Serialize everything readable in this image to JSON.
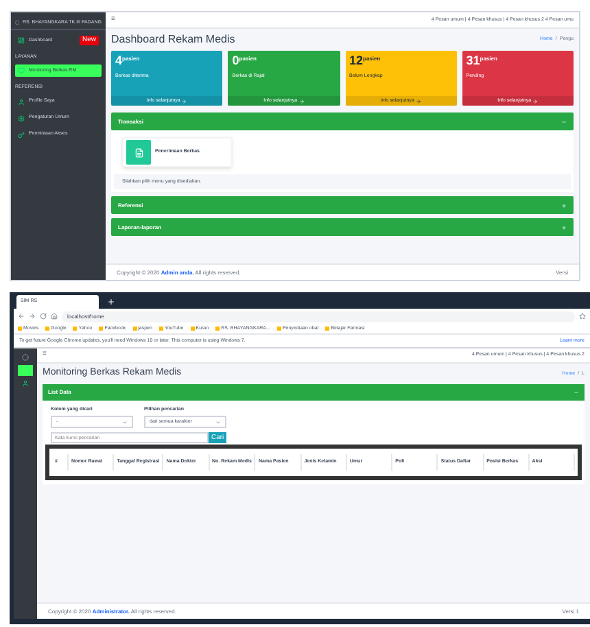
{
  "dashboard": {
    "sidebar": {
      "brand": "RS. BHAYANGKARA TK.III PADANG",
      "items": [
        {
          "kind": "link",
          "label": "Dashboard",
          "badge": "New",
          "selected": false
        },
        {
          "kind": "header",
          "label": "LAYANAN"
        },
        {
          "kind": "link",
          "label": "Monitoring Berkas RM",
          "selected": true
        },
        {
          "kind": "header",
          "label": "REFERENSI"
        },
        {
          "kind": "link",
          "label": "Profile Saya",
          "selected": false
        },
        {
          "kind": "link",
          "label": "Pengaturan Umum",
          "selected": false
        },
        {
          "kind": "link",
          "label": "Permintaan Akses",
          "selected": false
        }
      ]
    },
    "topbar": {
      "menu": "≡",
      "messages": "4 Pesan umum | 4 Pesan khusus | 4 Pesan khusus 2 4 Pesan umu"
    },
    "title": "Dashboard Rekam Medis",
    "breadcrumb": [
      "Home",
      "/",
      "Pengu"
    ],
    "stats": [
      {
        "value": "4",
        "unit": "pasien",
        "label": "Berkas diterima",
        "link": "Info selanjutnya",
        "color": "#17a2b8"
      },
      {
        "value": "0",
        "unit": "pasien",
        "label": "Berkas di Rajal",
        "link": "Info selanjutnya",
        "color": "#28a745"
      },
      {
        "value": "12",
        "unit": "pasien",
        "label": "Belum Lengkap",
        "link": "Info selanjutnya",
        "color": "#ffc107"
      },
      {
        "value": "31",
        "unit": "pasien",
        "label": "Pending",
        "link": "Info selanjutnya",
        "color": "#dc3545"
      }
    ],
    "sections": [
      {
        "title": "Transaksi",
        "expanded": true,
        "tiles": [
          "Penerimaan Berkas"
        ],
        "hint": "Silahkan pilih menu yang disediakan."
      },
      {
        "title": "Referensi",
        "expanded": false
      },
      {
        "title": "Laporan-laporan",
        "expanded": false
      }
    ],
    "footer": {
      "prefix": "Copyright © 2020 ",
      "link": "Admin anda.",
      "suffix": " All rights reserved.",
      "version": "Versi"
    }
  },
  "monitoring": {
    "browser": {
      "tab": "SIM RS",
      "address": "localhost/home",
      "bookmarks": [
        "Movies",
        "Google",
        "Yahoo",
        "Facebook",
        "jaspen",
        "YouTube",
        "Kuran",
        "RS. BHAYANGKARA...",
        "Penyediaan obat",
        "Belajar Farmasi"
      ],
      "notice": "To get future Google Chrome updates, you'll need Windows 10 or later. This computer is using Windows 7.",
      "notice_link": "Learn more"
    },
    "topbar": {
      "menu": "≡",
      "messages": "4 Pesan umum | 4 Pesan khusus | 4 Pesan khusus 2"
    },
    "title": "Monitoring Berkas Rekam Medis",
    "breadcrumb": [
      "Home",
      "/",
      "L"
    ],
    "panel_title": "List Data",
    "filters": [
      {
        "label": "Kolom yang dicari",
        "value": "-"
      },
      {
        "label": "Pilihan pencarian",
        "value": "dari semua karakter"
      }
    ],
    "search": {
      "placeholder": "Kata kunci pencarian",
      "button": "Cari"
    },
    "table": {
      "columns": [
        "#",
        "Nomor Rawat",
        "Tanggal Registrasi",
        "Nama Dokter",
        "No. Rekam Medis",
        "Nama Pasien",
        "Jenis Kelamin",
        "Umur",
        "Poli",
        "Status Daftar",
        "Posisi Berkas",
        "Aksi"
      ]
    },
    "footer": {
      "prefix": "Copyright © 2020 ",
      "link": "Administrator.",
      "suffix": " All rights reserved.",
      "version": "Versi 1"
    }
  }
}
